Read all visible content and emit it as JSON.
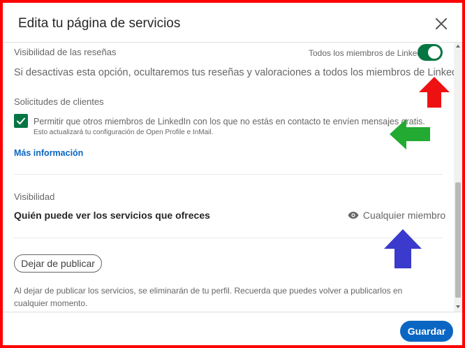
{
  "dialog": {
    "title": "Edita tu página de servicios",
    "close_icon": "close-icon"
  },
  "reviews": {
    "section_label": "Visibilidad de las reseñas",
    "toggle_label": "Todos los miembros de LinkedIn",
    "toggle_on": true,
    "description": "Si desactivas esta opción, ocultaremos tus reseñas y valoraciones a todos los miembros de LinkedIn"
  },
  "requests": {
    "section_label": "Solicitudes de clientes",
    "checkbox_checked": true,
    "checkbox_label": "Permitir que otros miembros de LinkedIn con los que no estás en contacto te envíen mensajes gratis.",
    "checkbox_sublabel": "Esto actualizará tu configuración de Open Profile e InMail.",
    "more_info_link": "Más información"
  },
  "visibility": {
    "section_label": "Visibilidad",
    "heading": "Quién puede ver los servicios que ofreces",
    "value": "Cualquier miembro",
    "value_icon": "eye-icon"
  },
  "unpublish": {
    "button_label": "Dejar de publicar",
    "note": "Al dejar de publicar los servicios, se eliminarán de tu perfil. Recuerda que puedes volver a publicarlos en cualquier momento."
  },
  "footer": {
    "save_label": "Guardar"
  },
  "annotations": {
    "frame_color": "#ff0000",
    "red_arrow_color": "#ee1111",
    "green_arrow_color": "#22aa33",
    "blue_arrow_color": "#3a3acc"
  }
}
